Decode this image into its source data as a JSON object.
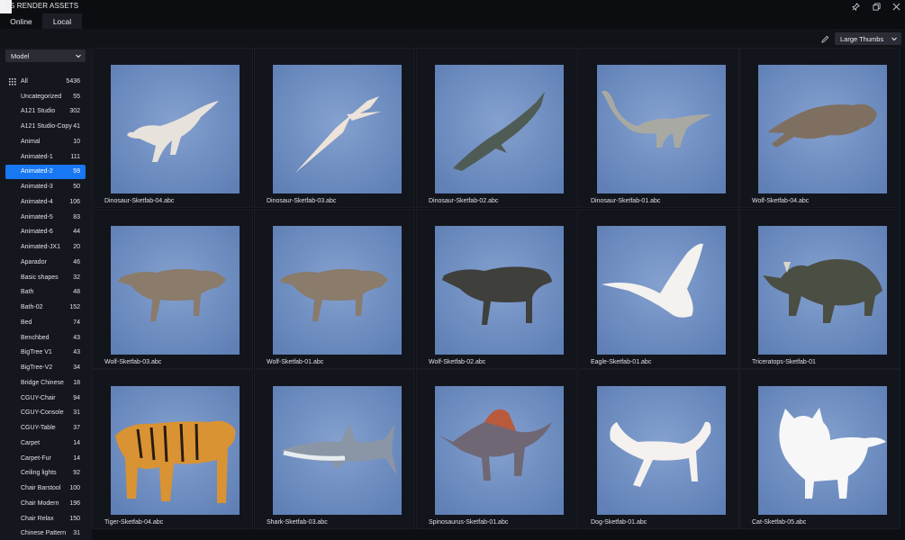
{
  "window": {
    "title": "D5 RENDER ASSETS"
  },
  "tabs": [
    {
      "label": "Online"
    },
    {
      "label": "Local"
    }
  ],
  "toolbar": {
    "view_mode": "Large Thumbs"
  },
  "sidebar": {
    "filter_select": "Model",
    "categories": [
      {
        "label": "All",
        "count": "5436"
      },
      {
        "label": "Uncategorized",
        "count": "55"
      },
      {
        "label": "A121 Studio",
        "count": "302"
      },
      {
        "label": "A121 Studio-Copy",
        "count": "41"
      },
      {
        "label": "Animal",
        "count": "10"
      },
      {
        "label": "Animated-1",
        "count": "111"
      },
      {
        "label": "Animated-2",
        "count": "59"
      },
      {
        "label": "Animated-3",
        "count": "50"
      },
      {
        "label": "Animated-4",
        "count": "106"
      },
      {
        "label": "Animated-5",
        "count": "83"
      },
      {
        "label": "Animated-6",
        "count": "44"
      },
      {
        "label": "Animated-JX1",
        "count": "20"
      },
      {
        "label": "Aparador",
        "count": "46"
      },
      {
        "label": "Basic shapes",
        "count": "32"
      },
      {
        "label": "Bath",
        "count": "48"
      },
      {
        "label": "Bath-02",
        "count": "152"
      },
      {
        "label": "Bed",
        "count": "74"
      },
      {
        "label": "Benchbed",
        "count": "43"
      },
      {
        "label": "BigTree V1",
        "count": "43"
      },
      {
        "label": "BigTree-V2",
        "count": "34"
      },
      {
        "label": "Bridge Chinese",
        "count": "18"
      },
      {
        "label": "CGUY-Chair",
        "count": "94"
      },
      {
        "label": "CGUY-Console",
        "count": "31"
      },
      {
        "label": "CGUY-Table",
        "count": "37"
      },
      {
        "label": "Carpet",
        "count": "14"
      },
      {
        "label": "Carpet-Fur",
        "count": "14"
      },
      {
        "label": "Ceiling lights",
        "count": "92"
      },
      {
        "label": "Chair Barstool",
        "count": "100"
      },
      {
        "label": "Chair Modern",
        "count": "196"
      },
      {
        "label": "Chair Relax",
        "count": "150"
      },
      {
        "label": "Chinese Pattern",
        "count": "31"
      }
    ]
  },
  "assets": [
    {
      "name": "Dinosaur-Sketfab-04.abc",
      "subject": "velociraptor"
    },
    {
      "name": "Dinosaur-Sketfab-03.abc",
      "subject": "pterosaur"
    },
    {
      "name": "Dinosaur-Sketfab-02.abc",
      "subject": "mosasaur"
    },
    {
      "name": "Dinosaur-Sketfab-01.abc",
      "subject": "sauropod"
    },
    {
      "name": "Wolf-Sketfab-04.abc",
      "subject": "wolf-leaping"
    },
    {
      "name": "Wolf-Sketfab-03.abc",
      "subject": "wolf-running"
    },
    {
      "name": "Wolf-Sketfab-01.abc",
      "subject": "wolf-running"
    },
    {
      "name": "Wolf-Sketfab-02.abc",
      "subject": "wolf-black"
    },
    {
      "name": "Eagle-Sketfab-01.abc",
      "subject": "eagle"
    },
    {
      "name": "Triceratops-Sketfab-01",
      "subject": "triceratops"
    },
    {
      "name": "Tiger-Sketfab-04.abc",
      "subject": "tiger"
    },
    {
      "name": "Shark-Sketfab-03.abc",
      "subject": "shark"
    },
    {
      "name": "Spinosaurus-Sketfab-01.abc",
      "subject": "spinosaurus"
    },
    {
      "name": "Dog-Sketfab-01.abc",
      "subject": "dog"
    },
    {
      "name": "Cat-Sketfab-05.abc",
      "subject": "cat"
    }
  ]
}
